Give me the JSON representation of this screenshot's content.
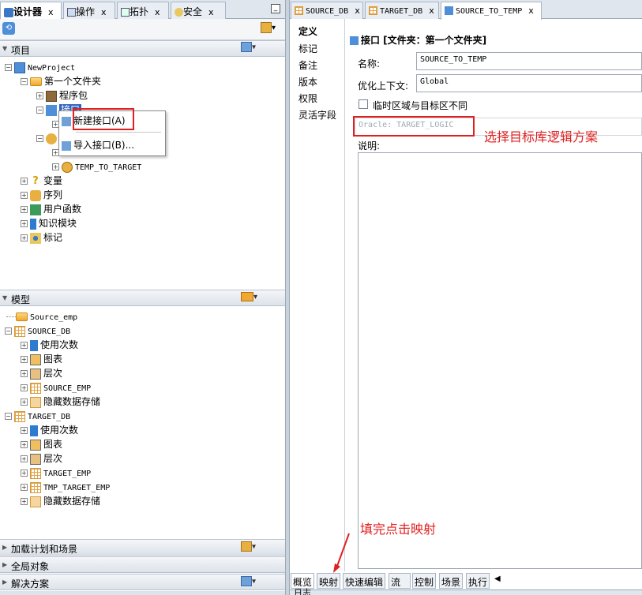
{
  "left_tabs": [
    {
      "label": "设计器",
      "icon": "designer-icon"
    },
    {
      "label": "操作",
      "icon": "operation-icon"
    },
    {
      "label": "拓扑",
      "icon": "topology-icon"
    },
    {
      "label": "安全",
      "icon": "security-icon"
    }
  ],
  "right_tabs": [
    {
      "label": "SOURCE_DB"
    },
    {
      "label": "TARGET_DB"
    },
    {
      "label": "SOURCE_TO_TEMP"
    }
  ],
  "project_section": {
    "title": "项目"
  },
  "project_tree": {
    "root": "NewProject",
    "folder": "第一个文件夹",
    "packages": "程序包",
    "interfaces": "接口",
    "interface_item": "TEMP_TO_TARGET",
    "variables": "变量",
    "sequences": "序列",
    "user_functions": "用户函数",
    "knowledge_modules": "知识模块",
    "markers": "标记"
  },
  "context_menu": {
    "new_interface": "新建接口(A)",
    "import_interface": "导入接口(B)..."
  },
  "model_section": {
    "title": "模型"
  },
  "model_tree": {
    "source_emp": "Source_emp",
    "source_db": "SOURCE_DB",
    "usage": "使用次数",
    "diagram": "图表",
    "hierarchy": "层次",
    "source_emp_tbl": "SOURCE_EMP",
    "hidden_store": "隐藏数据存储",
    "target_db": "TARGET_DB",
    "usage2": "使用次数",
    "diagram2": "图表",
    "hierarchy2": "层次",
    "target_emp": "TARGET_EMP",
    "tmp_target_emp": "TMP_TARGET_EMP",
    "hidden_store2": "隐藏数据存储"
  },
  "bottom_sections": [
    "加载计划和场景",
    "全局对象",
    "解决方案"
  ],
  "editor_nav": [
    "定义",
    "标记",
    "备注",
    "版本",
    "权限",
    "灵活字段"
  ],
  "editor": {
    "header": "接口 [文件夹：第一个文件夹]",
    "name_label": "名称:",
    "name_value": "SOURCE_TO_TEMP",
    "context_label": "优化上下文:",
    "context_value": "Global",
    "checkbox_label": "临时区域与目标区不同",
    "logic_schema": "Oracle: TARGET_LOGIC",
    "description_label": "说明:"
  },
  "bottom_tabs": [
    "概览",
    "映射",
    "快速编辑",
    "流",
    "控制",
    "场景",
    "执行"
  ],
  "annotations": {
    "logic_note": "选择目标库逻辑方案",
    "mapping_note": "填完点击映射"
  },
  "log_tab": "日志"
}
